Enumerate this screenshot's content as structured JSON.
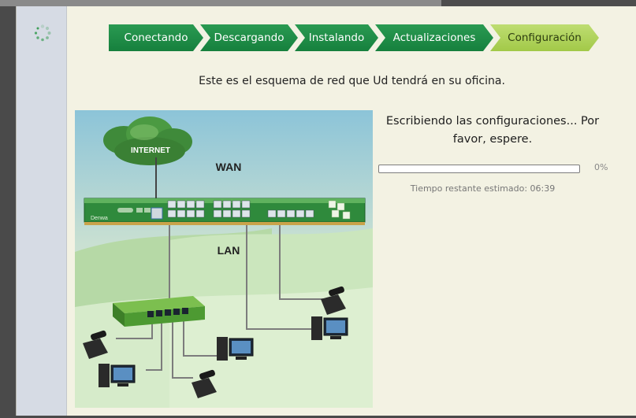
{
  "steps": [
    {
      "label": "Conectando",
      "state": "done"
    },
    {
      "label": "Descargando",
      "state": "done"
    },
    {
      "label": "Instalando",
      "state": "done"
    },
    {
      "label": "Actualizaciones",
      "state": "done"
    },
    {
      "label": "Configuración",
      "state": "current"
    }
  ],
  "subtitle": "Este es el esquema de red que Ud tendrá en su oficina.",
  "diagram": {
    "internet_label": "INTERNET",
    "wan_label": "WAN",
    "lan_label": "LAN",
    "brand_label": "Denwa"
  },
  "status": {
    "message": "Escribiendo las configuraciones... Por favor, espere.",
    "progress": 0,
    "progress_label": "0%",
    "time_prefix": "Tiempo restante estimado:",
    "time_value": "06:39"
  },
  "colors": {
    "step_done": "#1f8f48",
    "step_current": "#b2d45c",
    "sidebar": "#d6dbe4",
    "panel": "#f3f2e3"
  },
  "icons": [
    "loading-spinner-icon",
    "cloud-icon",
    "router-icon",
    "switch-icon",
    "desk-phone-icon",
    "desktop-computer-icon"
  ]
}
